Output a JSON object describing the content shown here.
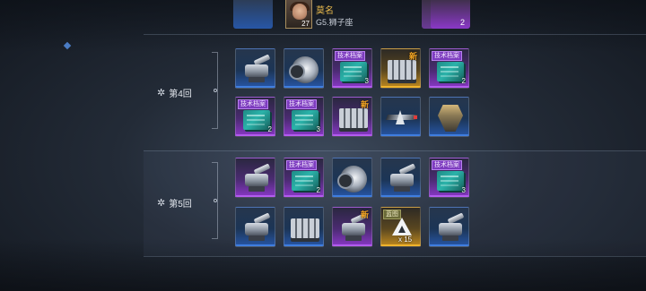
{
  "header": {
    "user_name": "莫名",
    "user_rank": "G5.狮子座",
    "avatar_level": "27",
    "top_right_count": "2"
  },
  "rounds": [
    {
      "label": "第4回",
      "rows": [
        [
          {
            "rarity": "blue",
            "icon": "launcher-icon",
            "tag": "",
            "new": "",
            "count": ""
          },
          {
            "rarity": "blue",
            "icon": "drum-turret-icon",
            "tag": "",
            "new": "",
            "count": ""
          },
          {
            "rarity": "purple",
            "icon": "tech-file-icon",
            "tag": "技术档案",
            "new": "",
            "count": "3"
          },
          {
            "rarity": "gold",
            "icon": "missile-rack-icon",
            "tag": "",
            "new": "新",
            "count": ""
          },
          {
            "rarity": "purple",
            "icon": "tech-file-icon",
            "tag": "技术档案",
            "new": "",
            "count": "2"
          }
        ],
        [
          {
            "rarity": "purple",
            "icon": "tech-file-icon",
            "tag": "技术档案",
            "new": "",
            "count": "2"
          },
          {
            "rarity": "purple",
            "icon": "tech-file-icon",
            "tag": "技术档案",
            "new": "",
            "count": "3"
          },
          {
            "rarity": "purple",
            "icon": "missile-rack-icon",
            "tag": "",
            "new": "新",
            "count": ""
          },
          {
            "rarity": "blue",
            "icon": "jet-icon",
            "tag": "",
            "new": "",
            "count": ""
          },
          {
            "rarity": "blue",
            "icon": "claw-icon",
            "tag": "",
            "new": "",
            "count": ""
          }
        ]
      ]
    },
    {
      "label": "第5回",
      "rows": [
        [
          {
            "rarity": "purple",
            "icon": "cannon-icon",
            "tag": "",
            "new": "",
            "count": ""
          },
          {
            "rarity": "purple",
            "icon": "tech-file-icon",
            "tag": "技术档案",
            "new": "",
            "count": "2"
          },
          {
            "rarity": "blue",
            "icon": "drum-turret-icon",
            "tag": "",
            "new": "",
            "count": ""
          },
          {
            "rarity": "blue",
            "icon": "cannon-icon",
            "tag": "",
            "new": "",
            "count": ""
          },
          {
            "rarity": "purple",
            "icon": "tech-file-icon",
            "tag": "技术档案",
            "new": "",
            "count": "3"
          }
        ],
        [
          {
            "rarity": "blue",
            "icon": "turret-icon",
            "tag": "",
            "new": "",
            "count": ""
          },
          {
            "rarity": "blue",
            "icon": "missile-rack-icon",
            "tag": "",
            "new": "",
            "count": ""
          },
          {
            "rarity": "purple",
            "icon": "launcher-icon",
            "tag": "",
            "new": "新",
            "count": ""
          },
          {
            "rarity": "gold",
            "icon": "blueprint-icon",
            "tag": "蓝图",
            "new": "",
            "count": "x 15"
          },
          {
            "rarity": "blue",
            "icon": "cannon-icon",
            "tag": "",
            "new": "",
            "count": ""
          }
        ]
      ]
    }
  ],
  "colors": {
    "blue": "#2756a6",
    "purple": "#8a38c7",
    "gold": "#c08a1f",
    "new_badge": "#f5a623",
    "name": "#e7b84c"
  }
}
